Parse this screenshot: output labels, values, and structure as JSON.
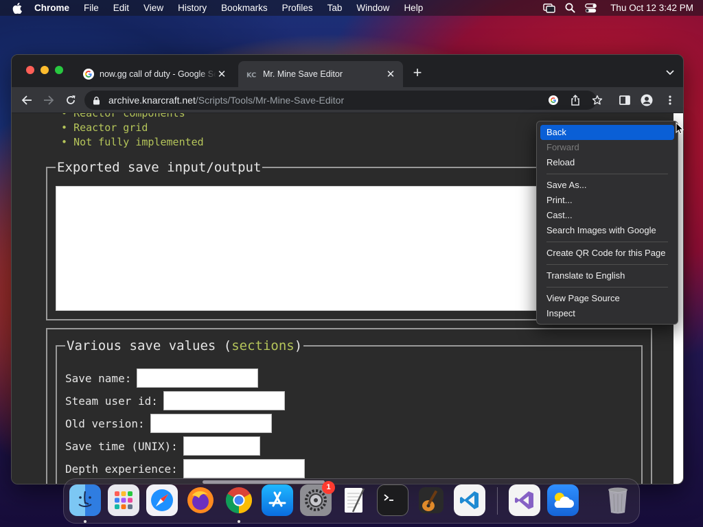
{
  "menubar": {
    "app_name": "Chrome",
    "items": [
      "File",
      "Edit",
      "View",
      "History",
      "Bookmarks",
      "Profiles",
      "Tab",
      "Window",
      "Help"
    ],
    "clock": "Thu Oct 12  3:42 PM"
  },
  "browser": {
    "tabs": [
      {
        "title": "now.gg call of duty - Google Search",
        "favicon": "google-g-icon",
        "active": false
      },
      {
        "title": "Mr. Mine Save Editor",
        "favicon": "kc-logo-icon",
        "active": true
      }
    ],
    "url_host": "archive.knarcraft.net",
    "url_path": "/Scripts/Tools/Mr-Mine-Save-Editor"
  },
  "page": {
    "bullets": [
      "Reactor components",
      "Reactor grid",
      "Not fully implemented"
    ],
    "export_legend": "Exported save input/output",
    "values_legend_prefix": "Various save values (",
    "values_legend_link": "sections",
    "values_legend_suffix": ")",
    "fields": [
      {
        "label": "Save name:",
        "value": ""
      },
      {
        "label": "Steam user id:",
        "value": ""
      },
      {
        "label": "Old version:",
        "value": ""
      },
      {
        "label": "Save time (UNIX):",
        "value": ""
      },
      {
        "label": "Depth experience:",
        "value": ""
      }
    ]
  },
  "context_menu": {
    "groups": [
      [
        {
          "label": "Back",
          "state": "selected"
        },
        {
          "label": "Forward",
          "state": "disabled"
        },
        {
          "label": "Reload",
          "state": "normal"
        }
      ],
      [
        {
          "label": "Save As...",
          "state": "normal"
        },
        {
          "label": "Print...",
          "state": "normal"
        },
        {
          "label": "Cast...",
          "state": "normal"
        },
        {
          "label": "Search Images with Google",
          "state": "normal"
        }
      ],
      [
        {
          "label": "Create QR Code for this Page",
          "state": "normal"
        }
      ],
      [
        {
          "label": "Translate to English",
          "state": "normal"
        }
      ],
      [
        {
          "label": "View Page Source",
          "state": "normal"
        },
        {
          "label": "Inspect",
          "state": "normal"
        }
      ]
    ]
  },
  "dock": {
    "apps": [
      "finder-icon",
      "launchpad-icon",
      "safari-icon",
      "firefox-icon",
      "chrome-icon",
      "app-store-icon",
      "system-settings-icon",
      "textedit-icon",
      "terminal-icon",
      "garageband-icon",
      "vscode-icon",
      "visual-studio-icon",
      "weather-icon",
      "trash-icon"
    ],
    "settings_badge": "1"
  },
  "colors": {
    "accent_green": "#b5c55a",
    "menu_highlight": "#0a5fd6"
  }
}
